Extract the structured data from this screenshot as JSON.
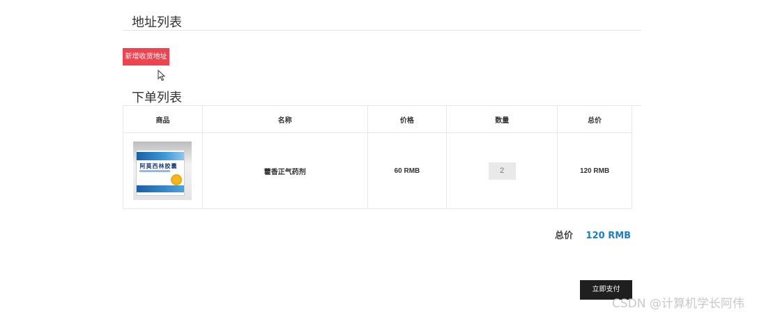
{
  "address_section": {
    "title": "地址列表",
    "add_button": "新增收货地址"
  },
  "order_section": {
    "title": "下单列表",
    "columns": [
      "商品",
      "名称",
      "价格",
      "数量",
      "总价"
    ],
    "rows": [
      {
        "image_icon": "medicine-box-image",
        "image_text": "阿莫西林胶囊",
        "name": "藿香正气药剂",
        "price": "60 RMB",
        "quantity": "2",
        "total": "120 RMB"
      }
    ]
  },
  "summary": {
    "label": "总价",
    "value": "120 RMB"
  },
  "pay_button": "立即支付",
  "watermark": "CSDN @计算机学长阿伟",
  "colors": {
    "add_button": "#f0434f",
    "total_value": "#1a7fc4",
    "pay_button": "#1f1f1f"
  }
}
